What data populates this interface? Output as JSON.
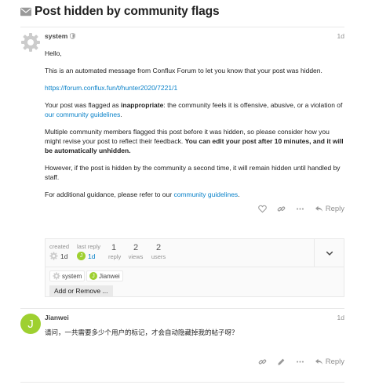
{
  "topic": {
    "title": "Post hidden by community flags"
  },
  "post1": {
    "username": "system",
    "date": "1d",
    "greeting": "Hello,",
    "intro": "This is an automated message from Conflux Forum to let you know that your post was hidden.",
    "link": "https://forum.conflux.fun/t/hunter2020/7221/1",
    "flagged_prefix": "Your post was flagged as ",
    "flagged_reason": "inappropriate",
    "flagged_suffix": ": the community feels it is offensive, abusive, or a violation of ",
    "guidelines_link": "our community guidelines",
    "flagged_end": ".",
    "multi_text": "Multiple community members flagged this post before it was hidden, so please consider how you might revise your post to reflect their feedback. ",
    "multi_bold": "You can edit your post after 10 minutes, and it will be automatically unhidden.",
    "second_time": "However, if the post is hidden by the community a second time, it will remain hidden until handled by staff.",
    "guidance_prefix": "For additional guidance, please refer to our ",
    "guidance_link": "community guidelines",
    "guidance_end": ".",
    "reply_label": "Reply"
  },
  "topic_map": {
    "created_label": "created",
    "created_value": "1d",
    "last_reply_label": "last reply",
    "last_reply_value": "1d",
    "replies_count": "1",
    "replies_label": "reply",
    "views_count": "2",
    "views_label": "views",
    "users_count": "2",
    "users_label": "users",
    "participants": [
      {
        "name": "system"
      },
      {
        "name": "Jianwei",
        "initial": "J"
      }
    ],
    "add_remove_label": "Add or Remove ..."
  },
  "post2": {
    "avatar_initial": "J",
    "username": "Jianwei",
    "date": "1d",
    "text": "请问，一共需要多少个用户的标记，才会自动隐藏掉我的帖子呀？",
    "reply_label": "Reply"
  },
  "colors": {
    "link": "#0a82c9",
    "avatar_green": "#9ed030",
    "muted": "#919191"
  }
}
